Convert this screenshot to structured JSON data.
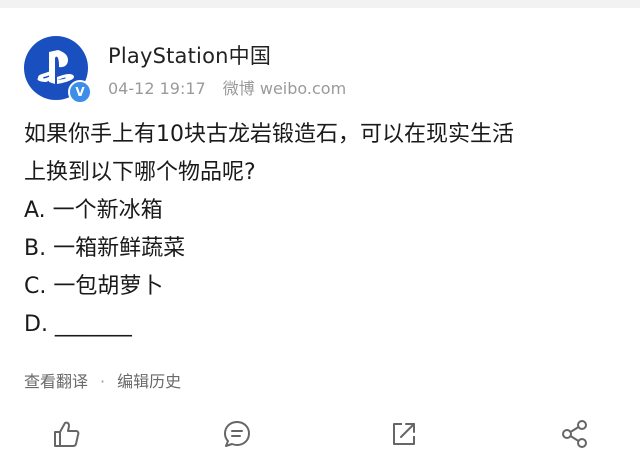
{
  "post": {
    "user_name": "PlayStation中国",
    "verified_badge": "V",
    "date": "04-12 19:17",
    "source": "微博 weibo.com",
    "body_lines": [
      "如果你手上有10块古龙岩锻造石，可以在现实生活",
      "上换到以下哪个物品呢?",
      "A. 一个新冰箱",
      "B. 一箱新鲜蔬菜",
      "C. 一包胡萝卜",
      "D. _______"
    ],
    "view_translation": "查看翻译",
    "separator": "·",
    "edit_history": "编辑历史"
  },
  "actions": {
    "icons": [
      "like-icon",
      "comment-icon",
      "repost-icon",
      "share-icon"
    ]
  },
  "colors": {
    "brand_blue": "#1a4fbf",
    "verified_blue": "#3d8ee8",
    "meta_gray": "#9a9a9a"
  }
}
